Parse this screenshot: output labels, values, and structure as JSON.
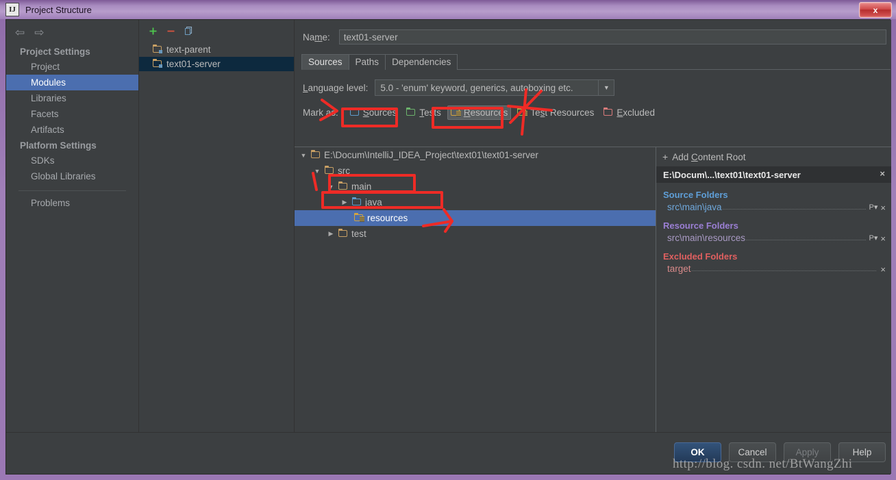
{
  "window": {
    "title": "Project Structure",
    "app_icon": "IJ",
    "close_label": "x"
  },
  "sidebar": {
    "back_icon": "⇦",
    "forward_icon": "⇨",
    "groups": [
      {
        "label": "Project Settings",
        "items": [
          {
            "label": "Project",
            "selected": false
          },
          {
            "label": "Modules",
            "selected": true
          },
          {
            "label": "Libraries",
            "selected": false
          },
          {
            "label": "Facets",
            "selected": false
          },
          {
            "label": "Artifacts",
            "selected": false
          }
        ]
      },
      {
        "label": "Platform Settings",
        "items": [
          {
            "label": "SDKs",
            "selected": false
          },
          {
            "label": "Global Libraries",
            "selected": false
          }
        ]
      }
    ],
    "extra": {
      "label": "Problems"
    }
  },
  "modules_panel": {
    "toolbar": {
      "add_label": "+",
      "remove_label": "−",
      "copy_label": "copy-icon"
    },
    "items": [
      {
        "label": "text-parent",
        "selected": false
      },
      {
        "label": "text01-server",
        "selected": true
      }
    ]
  },
  "main": {
    "name_label_pre": "Na",
    "name_label_mnemonic": "m",
    "name_label_post": "e:",
    "name_value": "text01-server",
    "tabs": [
      {
        "label": "Sources",
        "active": true
      },
      {
        "label": "Paths",
        "active": false
      },
      {
        "label": "Dependencies",
        "active": false
      }
    ],
    "language": {
      "label_mnemonic": "L",
      "label_rest": "anguage level:",
      "value": "5.0 - 'enum' keyword, generics, autoboxing etc.",
      "arrow_icon": "▼"
    },
    "mark_as": {
      "label": "Mark as:",
      "options": [
        {
          "pre": "",
          "mnemonic": "S",
          "post": "ources",
          "icon": "folder-sources-icon",
          "color": "#5e9ccc",
          "pressed": false,
          "boxed": true
        },
        {
          "pre": "",
          "mnemonic": "T",
          "post": "ests",
          "icon": "folder-tests-icon",
          "color": "#6cb36c",
          "pressed": false,
          "boxed": false
        },
        {
          "pre": "",
          "mnemonic": "R",
          "post": "esources",
          "icon": "folder-resources-icon",
          "color": "#d2a441",
          "pressed": true,
          "boxed": true
        },
        {
          "pre": "Te",
          "mnemonic": "s",
          "post": "t Resources",
          "icon": "folder-test-resources-icon",
          "color": "#9cbf4a",
          "pressed": false,
          "boxed": false
        },
        {
          "pre": "",
          "mnemonic": "E",
          "post": "xcluded",
          "icon": "folder-excluded-icon",
          "color": "#d97b7b",
          "pressed": false,
          "boxed": false
        }
      ]
    }
  },
  "tree": {
    "rows": [
      {
        "label": "E:\\Docum\\IntelliJ_IDEA_Project\\text01\\text01-server",
        "indent": 0,
        "twisty": "▼",
        "icon_color": "#c9a064",
        "icon_kind": "plain",
        "selected": false,
        "boxed": false
      },
      {
        "label": "src",
        "indent": 1,
        "twisty": "▼",
        "icon_color": "#c9a064",
        "icon_kind": "plain",
        "selected": false,
        "boxed": false
      },
      {
        "label": "main",
        "indent": 2,
        "twisty": "▼",
        "icon_color": "#c9a064",
        "icon_kind": "plain",
        "selected": false,
        "boxed": false
      },
      {
        "label": "java",
        "indent": 3,
        "twisty": "▶",
        "icon_color": "#5e9ccc",
        "icon_kind": "plain",
        "selected": false,
        "boxed": true
      },
      {
        "label": "resources",
        "indent": 4,
        "twisty": "",
        "icon_color": "#d2a441",
        "icon_kind": "resource",
        "selected": true,
        "boxed": true
      },
      {
        "label": "test",
        "indent": 2,
        "twisty": "▶",
        "icon_color": "#c9a064",
        "icon_kind": "plain",
        "selected": false,
        "boxed": false
      }
    ]
  },
  "content_roots": {
    "add_label_pre": "Add ",
    "add_mnemonic": "C",
    "add_label_post": "ontent Root",
    "add_icon": "plus-icon",
    "root_path": "E:\\Docum\\...\\text01\\text01-server",
    "root_close_icon": "×",
    "sections": [
      {
        "title": "Source Folders",
        "color": "#5f9fd8",
        "entries": [
          {
            "path": "src\\main\\java",
            "color": "#6fa8dc",
            "has_props": true,
            "props_icon": "P▾",
            "close_icon": "×"
          }
        ]
      },
      {
        "title": "Resource Folders",
        "color": "#9b7fd4",
        "entries": [
          {
            "path": "src\\main\\resources",
            "color": "#a99ac4",
            "has_props": true,
            "props_icon": "P▾",
            "close_icon": "×"
          }
        ]
      },
      {
        "title": "Excluded Folders",
        "color": "#e06060",
        "entries": [
          {
            "path": "target",
            "color": "#d98a8a",
            "has_props": false,
            "props_icon": "",
            "close_icon": "×"
          }
        ]
      }
    ]
  },
  "buttons": [
    {
      "label": "OK",
      "kind": "default"
    },
    {
      "label": "Cancel",
      "kind": "normal"
    },
    {
      "label": "Apply",
      "kind": "disabled"
    },
    {
      "label": "Help",
      "kind": "normal"
    }
  ],
  "watermark": {
    "text": "http://blog. csdn. net/BtWangZhi"
  },
  "annotations": {
    "color": "#ee2b26",
    "marks": [
      "arrow-pointing-at-sources",
      "box-around-sources",
      "box-around-resources",
      "scribble-four-over-test-resources",
      "tick-left-of-java",
      "box-around-java",
      "box-around-resources-tree-row",
      "arrow-pointing-at-resources-row"
    ]
  }
}
